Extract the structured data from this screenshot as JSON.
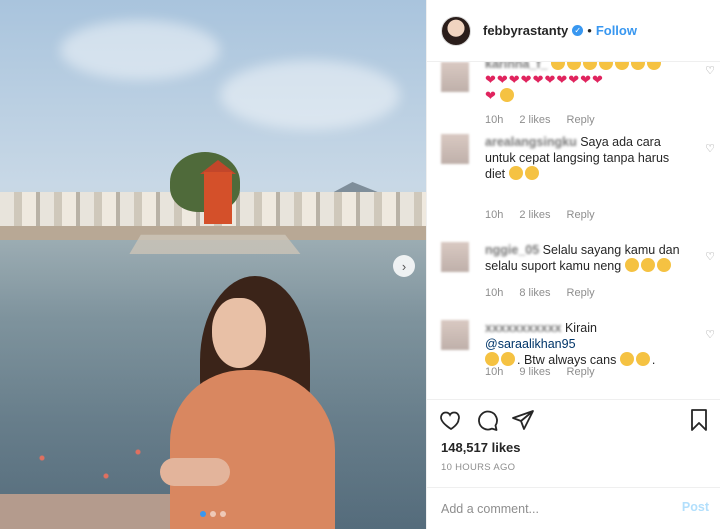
{
  "post": {
    "username": "febbyrastanty",
    "separator": "•",
    "follow_label": "Follow",
    "verified_icon": "verified-badge-icon",
    "carousel": {
      "next_icon": "chevron-right-icon",
      "next_glyph": "›",
      "slides": 3,
      "active_slide": 1
    }
  },
  "comments": [
    {
      "user_blurred": "karinna_f_",
      "text": "",
      "text_line2": "❤❤❤❤❤❤❤❤❤❤",
      "time": "10h",
      "likes": "2 likes",
      "reply": "Reply"
    },
    {
      "user_blurred": "arealangsingku",
      "text": "Saya ada cara untuk cepat langsing tanpa harus diet",
      "time": "10h",
      "likes": "2 likes",
      "reply": "Reply"
    },
    {
      "user_blurred": "nggie_05",
      "text": "Selalu sayang kamu dan selalu suport kamu neng",
      "time": "10h",
      "likes": "8 likes",
      "reply": "Reply"
    },
    {
      "user_blurred": "xxxxxxxxxxx",
      "text_prefix": "Kirain",
      "mention": "@saraalikhan95",
      "text_suffix": ". Btw always cans",
      "time": "10h",
      "likes": "9 likes",
      "reply": "Reply"
    }
  ],
  "actions": {
    "like_icon": "heart-outline-icon",
    "comment_icon": "comment-bubble-icon",
    "share_icon": "paper-plane-icon",
    "save_icon": "bookmark-icon"
  },
  "likes_count": "148,517 likes",
  "time_ago": "10 HOURS AGO",
  "add_comment": {
    "placeholder": "Add a comment...",
    "post_label": "Post"
  },
  "colors": {
    "accent": "#3897f0",
    "heart": "#e0245e",
    "text": "#262626",
    "muted": "#8e8e8e"
  }
}
